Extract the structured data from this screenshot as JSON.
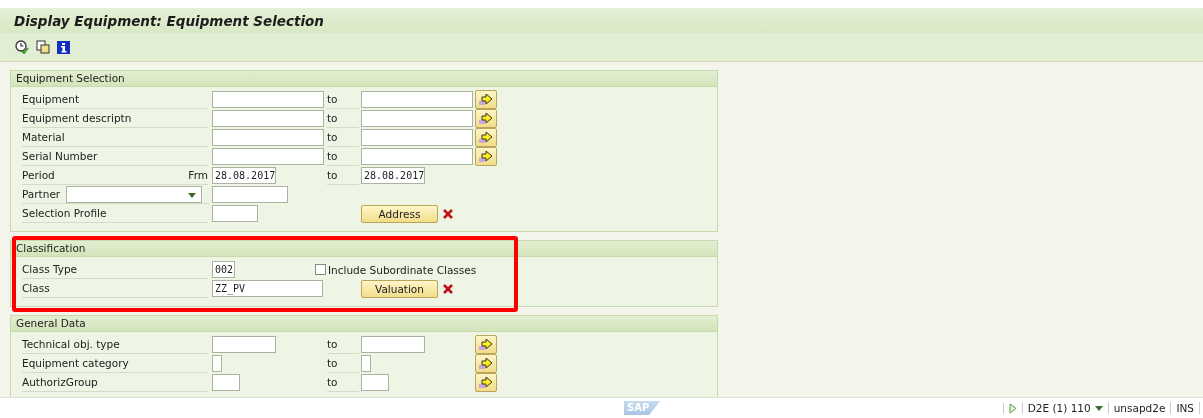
{
  "window": {
    "title": "Display Equipment: Equipment Selection"
  },
  "sections": [
    {
      "title": "Equipment Selection",
      "highlighted": false,
      "rows": [
        {
          "kind": "range",
          "label": "Equipment",
          "to": "to",
          "more_button": true
        },
        {
          "kind": "range",
          "label": "Equipment descriptn",
          "to": "to",
          "more_button": true
        },
        {
          "kind": "range",
          "label": "Material",
          "to": "to",
          "more_button": true
        },
        {
          "kind": "range",
          "label": "Serial Number",
          "to": "to",
          "more_button": true
        },
        {
          "kind": "range",
          "label": "Period",
          "from_label": "Frm",
          "value": "28.08.2017",
          "to": "to",
          "to_value": "28.08.2017",
          "more_button": false
        },
        {
          "kind": "dropdown",
          "label": "Partner"
        },
        {
          "kind": "action",
          "label": "Selection Profile",
          "button": "Address"
        }
      ]
    },
    {
      "title": "Classification",
      "highlighted": true,
      "rows": [
        {
          "kind": "checkbox",
          "label": "Class Type",
          "value": "002",
          "checkbox": {
            "label": "Include Subordinate Classes",
            "checked": false
          }
        },
        {
          "kind": "action",
          "label": "Class",
          "value": "ZZ_PV",
          "button": "Valuation"
        }
      ]
    },
    {
      "title": "General Data",
      "highlighted": false,
      "rows": [
        {
          "kind": "range",
          "label": "Technical obj. type",
          "to": "to",
          "more_button": true
        },
        {
          "kind": "range",
          "label": "Equipment category",
          "to": "to",
          "more_button": true
        },
        {
          "kind": "range",
          "label": "AuthorizGroup",
          "to": "to",
          "more_button": true
        }
      ]
    }
  ],
  "status_bar": {
    "logo": "SAP",
    "system": "D2E (1) 110",
    "server": "unsapd2e",
    "mode": "INS"
  }
}
